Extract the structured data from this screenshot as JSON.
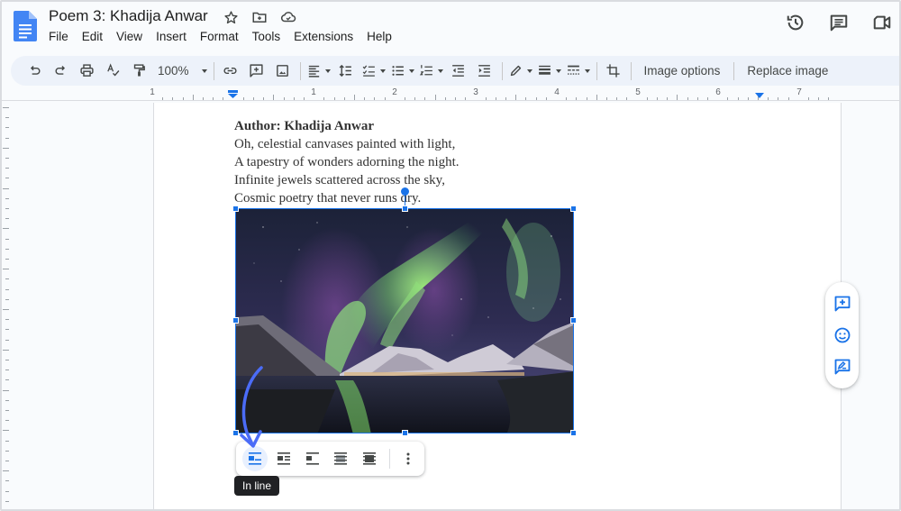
{
  "document": {
    "title": "Poem 3: Khadija Anwar"
  },
  "menu": [
    "File",
    "Edit",
    "View",
    "Insert",
    "Format",
    "Tools",
    "Extensions",
    "Help"
  ],
  "toolbar": {
    "zoom": "100%",
    "image_options_label": "Image options",
    "replace_image_label": "Replace image"
  },
  "ruler": {
    "labels": [
      "1",
      "1",
      "2",
      "3",
      "4",
      "5",
      "6",
      "7"
    ]
  },
  "content": {
    "author_line": "Author: Khadija Anwar",
    "lines": [
      "Oh, celestial canvases painted with light,",
      "A tapestry of wonders adorning the night.",
      "Infinite jewels scattered across the sky,",
      "Cosmic poetry that never runs dry."
    ],
    "image_description": "Aurora borealis over snowy mountains reflected in a fjord at night"
  },
  "image_toolbar": {
    "wrap_options": [
      "In line",
      "Wrap text",
      "Break text",
      "Behind text",
      "In front of text"
    ],
    "active_option": "In line",
    "tooltip": "In line"
  },
  "side_panel": [
    "Add comment",
    "Add emoji reaction",
    "Suggest edits"
  ],
  "colors": {
    "accent": "#1a73e8",
    "toolbar_bg": "#edf2fa",
    "arrow": "#4b6cf7"
  }
}
